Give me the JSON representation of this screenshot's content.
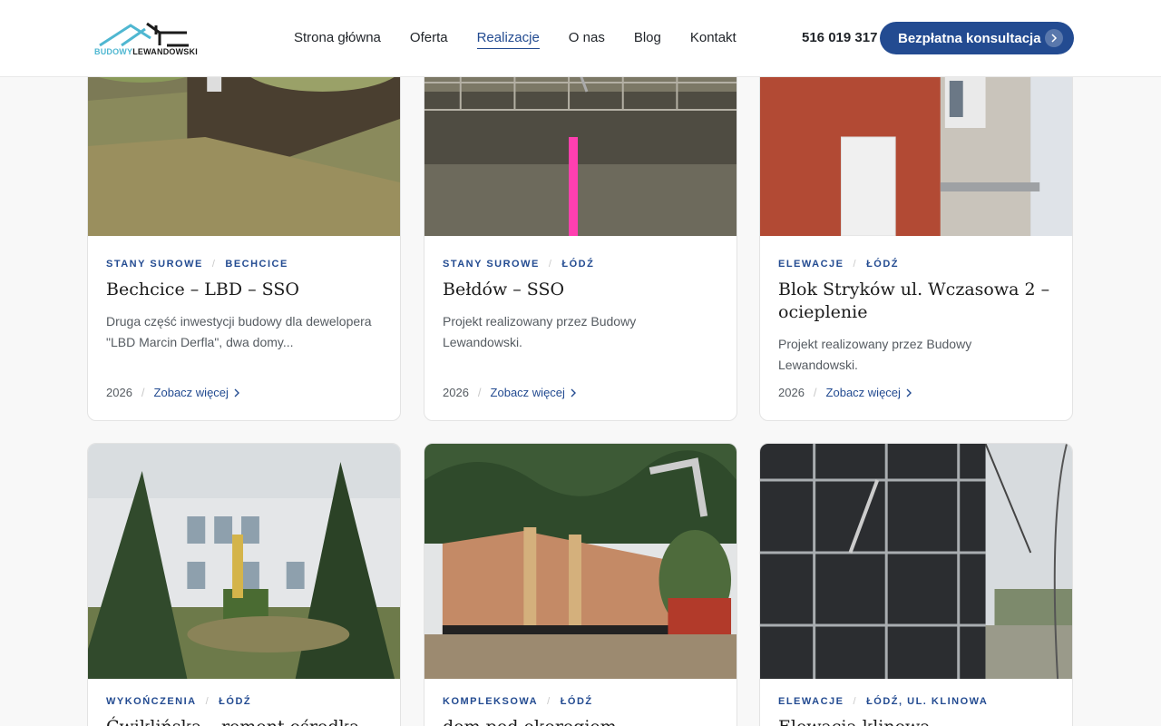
{
  "header": {
    "logo": {
      "word1": "BUDOWY",
      "word2": "LEWANDOWSKI"
    },
    "nav": [
      {
        "label": "Strona główna"
      },
      {
        "label": "Oferta"
      },
      {
        "label": "Realizacje"
      },
      {
        "label": "O nas"
      },
      {
        "label": "Blog"
      },
      {
        "label": "Kontakt"
      }
    ],
    "active_nav": "Realizacje",
    "phone": "516 019 317",
    "cta_label": "Bezpłatna konsultacja",
    "colors": {
      "accent": "#234b91",
      "logo_light": "#4fb7d1"
    }
  },
  "cards": [
    {
      "category": "Stany surowe",
      "location": "Bechcice",
      "title": "Bechcice – LBD – SSO",
      "description": "Druga część inwestycji budowy dla dewelopera \"LBD Marcin Derfla\", dwa domy...",
      "year": "2026",
      "more": "Zobacz więcej",
      "image": "excavation-photo"
    },
    {
      "category": "Stany surowe",
      "location": "Łódź",
      "title": "Bełdów – SSO",
      "description": "Projekt realizowany przez Budowy Lewandowski.",
      "year": "2026",
      "more": "Zobacz więcej",
      "image": "foundation-rebar-photo"
    },
    {
      "category": "Elewacje",
      "location": "Łódź",
      "title": "Blok Stryków ul. Wczasowa 2 – ocieplenie",
      "description": "Projekt realizowany przez Budowy Lewandowski.",
      "year": "2026",
      "more": "Zobacz więcej",
      "image": "brick-block-photo"
    },
    {
      "category": "Wykończenia",
      "location": "Łódź",
      "title": "Ćwiklińska – remont ośrodka",
      "description": "",
      "year": "",
      "more": "",
      "image": "school-renovation-photo"
    },
    {
      "category": "Kompleksowa",
      "location": "Łódź",
      "title": "dom pod okoregiem",
      "description": "",
      "year": "",
      "more": "",
      "image": "brick-walls-photo"
    },
    {
      "category": "Elewacje",
      "location": "Łódź, ul. Klinowa",
      "title": "Elewacja klinowa",
      "description": "",
      "year": "",
      "more": "",
      "image": "scaffolding-facade-photo"
    }
  ]
}
